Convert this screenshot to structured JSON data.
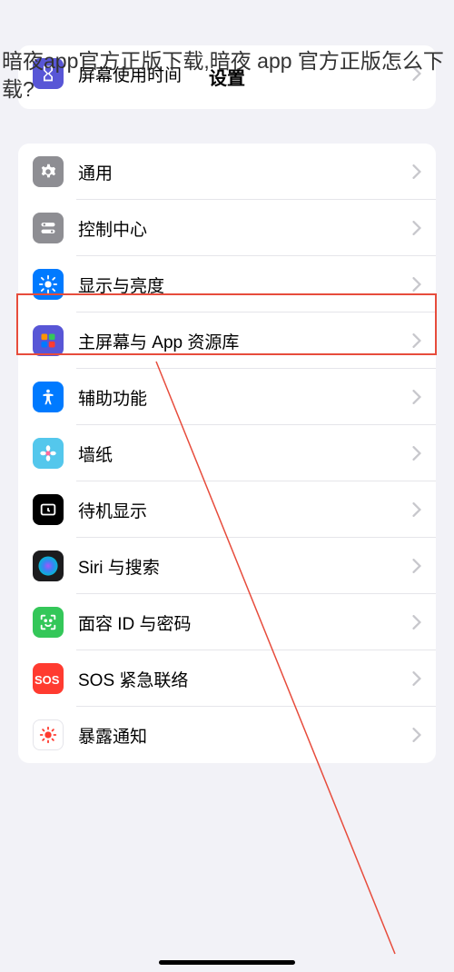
{
  "overlay_text": "暗夜app官方正版下载,暗夜 app 官方正版怎么下载?",
  "nav_title": "设置",
  "top_group": {
    "item": {
      "label": "屏幕使用时间",
      "icon_bg": "#5856d6"
    }
  },
  "main_group": {
    "items": [
      {
        "label": "通用",
        "icon_bg": "#8e8e93",
        "icon": "gear"
      },
      {
        "label": "控制中心",
        "icon_bg": "#8e8e93",
        "icon": "toggles"
      },
      {
        "label": "显示与亮度",
        "icon_bg": "#007aff",
        "icon": "brightness",
        "highlighted": true
      },
      {
        "label": "主屏幕与 App 资源库",
        "icon_bg": "#5856d6",
        "icon": "grid"
      },
      {
        "label": "辅助功能",
        "icon_bg": "#007aff",
        "icon": "accessibility"
      },
      {
        "label": "墙纸",
        "icon_bg": "#54c7ec",
        "icon": "flower"
      },
      {
        "label": "待机显示",
        "icon_bg": "#000000",
        "icon": "clock"
      },
      {
        "label": "Siri 与搜索",
        "icon_bg": "#1c1c1e",
        "icon": "siri"
      },
      {
        "label": "面容 ID 与密码",
        "icon_bg": "#34c759",
        "icon": "face"
      },
      {
        "label": "SOS 紧急联络",
        "icon_bg": "#ff3b30",
        "icon": "sos"
      },
      {
        "label": "暴露通知",
        "icon_bg": "#ffffff",
        "icon": "exposure"
      }
    ]
  }
}
